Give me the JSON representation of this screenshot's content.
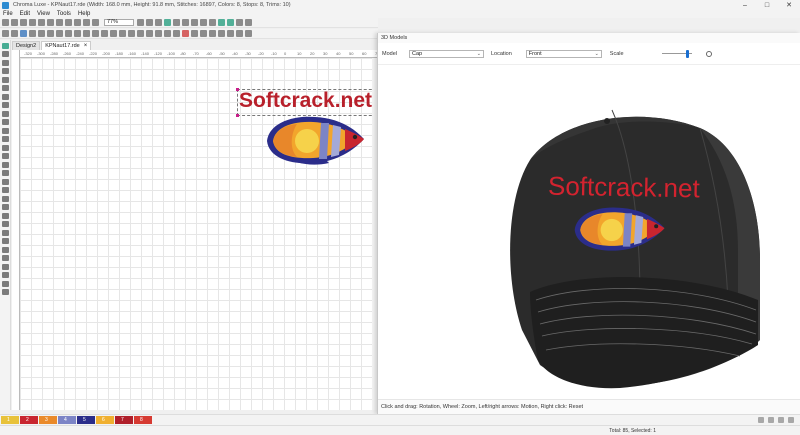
{
  "window": {
    "title": "Chroma Luxe - KPNaut17.rde (Width: 168.0 mm, Height: 91.8 mm, Stitches: 16897, Colors: 8, Stops: 8, Trims: 10)"
  },
  "menu": [
    "File",
    "Edit",
    "View",
    "Tools",
    "Help"
  ],
  "toolbar": {
    "zoom": "77%"
  },
  "tabs": [
    {
      "label": "Design2",
      "active": false
    },
    {
      "label": "KPNaut17.rde",
      "active": true
    }
  ],
  "ruler": {
    "top_ticks": [
      "-320",
      "-300",
      "-280",
      "-260",
      "-240",
      "-220",
      "-200",
      "-180",
      "-160",
      "-140",
      "-120",
      "-100",
      "-80",
      "-70",
      "-60",
      "-50",
      "-40",
      "-30",
      "-20",
      "-10",
      "0",
      "10",
      "20",
      "30",
      "40",
      "50",
      "60",
      "70"
    ]
  },
  "canvas": {
    "design_text": "Softcrack.net"
  },
  "dialog": {
    "title": "3D Models",
    "model_label": "Model",
    "model_value": "Cap",
    "location_label": "Location",
    "location_value": "Front",
    "scale_label": "Scale",
    "scale_level": 0.9,
    "cap_text": "Softcrack.net",
    "status": "Click and drag: Rotation, Wheel: Zoom, Left/right arrows: Motion, Right click: Reset"
  },
  "colors": [
    {
      "num": "1",
      "hex": "#e8c23a"
    },
    {
      "num": "2",
      "hex": "#c8252f"
    },
    {
      "num": "3",
      "hex": "#ea8a2a"
    },
    {
      "num": "4",
      "hex": "#7c84c6"
    },
    {
      "num": "5",
      "hex": "#2b2d8a"
    },
    {
      "num": "6",
      "hex": "#f0b030"
    },
    {
      "num": "7",
      "hex": "#b01f2a"
    },
    {
      "num": "8",
      "hex": "#d63a32"
    }
  ],
  "status": {
    "total": "Total: 85, Selected: 1"
  }
}
